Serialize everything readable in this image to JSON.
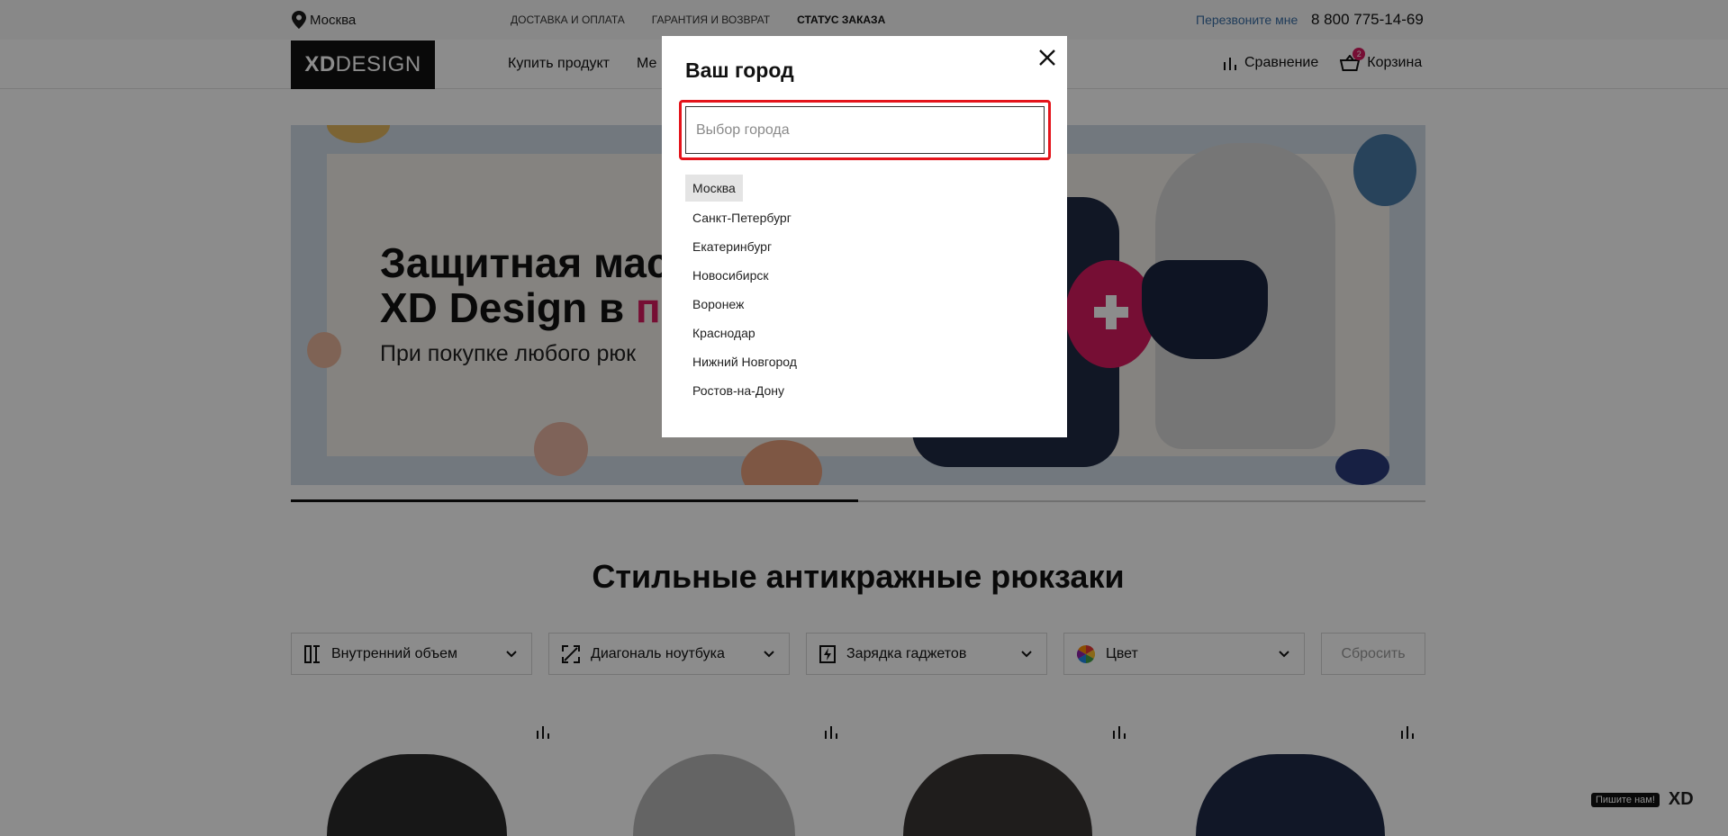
{
  "topbar": {
    "city": "Москва",
    "links": [
      "Доставка и оплата",
      "Гарантия и возврат",
      "Статус заказа"
    ],
    "callback": "Перезвоните мне",
    "phone": "8 800 775-14-69"
  },
  "header": {
    "logo_xd": "XD",
    "logo_design": "DESIGN",
    "nav": [
      "Купить продукт",
      "Ме"
    ],
    "compare": "Сравнение",
    "cart": "Корзина",
    "cart_count": "2"
  },
  "banner": {
    "line1": "Защитная мас",
    "line2_a": "XD Design в ",
    "line2_b": "по",
    "sub": "При покупке любого рюк",
    "slide_progress": 0.5
  },
  "section": {
    "title": "Стильные антикражные рюкзаки",
    "filters": [
      "Внутренний объем",
      "Диагональ ноутбука",
      "Зарядка гаджетов",
      "Цвет"
    ],
    "reset": "Сбросить"
  },
  "chat": {
    "label": "Пишите нам!",
    "brand": "XD"
  },
  "modal": {
    "title": "Ваш город",
    "input_placeholder": "Выбор города",
    "input_value": "",
    "cities": [
      "Москва",
      "Санкт-Петербург",
      "Екатеринбург",
      "Новосибирск",
      "Воронеж",
      "Краснодар",
      "Нижний Новгород",
      "Ростов-на-Дону"
    ],
    "selected_city": "Москва"
  },
  "colors": {
    "accent_pink": "#d81b60",
    "focus_red": "#e4141b",
    "link_blue": "#3a6ea5",
    "overlay": "rgba(0,0,0,0.45)"
  }
}
